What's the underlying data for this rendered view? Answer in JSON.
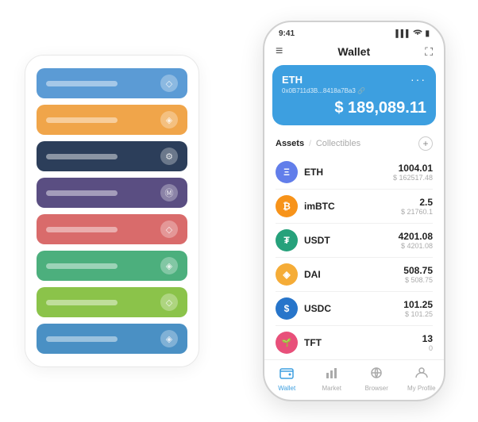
{
  "scene": {
    "background": "#fff"
  },
  "cardStack": {
    "items": [
      {
        "color": "card-blue",
        "icon": "◇"
      },
      {
        "color": "card-orange",
        "icon": "◈"
      },
      {
        "color": "card-dark",
        "icon": "⚙"
      },
      {
        "color": "card-purple",
        "icon": "Ⓜ"
      },
      {
        "color": "card-red",
        "icon": "◇"
      },
      {
        "color": "card-green",
        "icon": "◈"
      },
      {
        "color": "card-light-green",
        "icon": "◇"
      },
      {
        "color": "card-steel-blue",
        "icon": "◈"
      }
    ]
  },
  "phone": {
    "statusBar": {
      "time": "9:41",
      "signal": "▌▌▌",
      "wifi": "WiFi",
      "battery": "🔋"
    },
    "header": {
      "menuIcon": "≡",
      "title": "Wallet",
      "expandIcon": "⛶"
    },
    "ethCard": {
      "label": "ETH",
      "dots": "···",
      "address": "0x0B711d3B...8418a7Ba3  🔗",
      "amount": "$ 189,089.11"
    },
    "assetsSection": {
      "activeTab": "Assets",
      "inactiveTab": "Collectibles",
      "divider": "/",
      "addIcon": "+"
    },
    "assets": [
      {
        "name": "ETH",
        "iconBg": "#627eea",
        "iconText": "Ξ",
        "amount": "1004.01",
        "usd": "$ 162517.48"
      },
      {
        "name": "imBTC",
        "iconBg": "#f7931a",
        "iconText": "₿",
        "amount": "2.5",
        "usd": "$ 21760.1"
      },
      {
        "name": "USDT",
        "iconBg": "#26a17b",
        "iconText": "₮",
        "amount": "4201.08",
        "usd": "$ 4201.08"
      },
      {
        "name": "DAI",
        "iconBg": "#f5ac37",
        "iconText": "◈",
        "amount": "508.75",
        "usd": "$ 508.75"
      },
      {
        "name": "USDC",
        "iconBg": "#2775ca",
        "iconText": "$",
        "amount": "101.25",
        "usd": "$ 101.25"
      },
      {
        "name": "TFT",
        "iconBg": "#e8507a",
        "iconText": "🌱",
        "amount": "13",
        "usd": "0"
      }
    ],
    "bottomNav": [
      {
        "icon": "👛",
        "label": "Wallet",
        "active": true
      },
      {
        "icon": "📊",
        "label": "Market",
        "active": false
      },
      {
        "icon": "🔍",
        "label": "Browser",
        "active": false
      },
      {
        "icon": "👤",
        "label": "My Profile",
        "active": false
      }
    ]
  }
}
